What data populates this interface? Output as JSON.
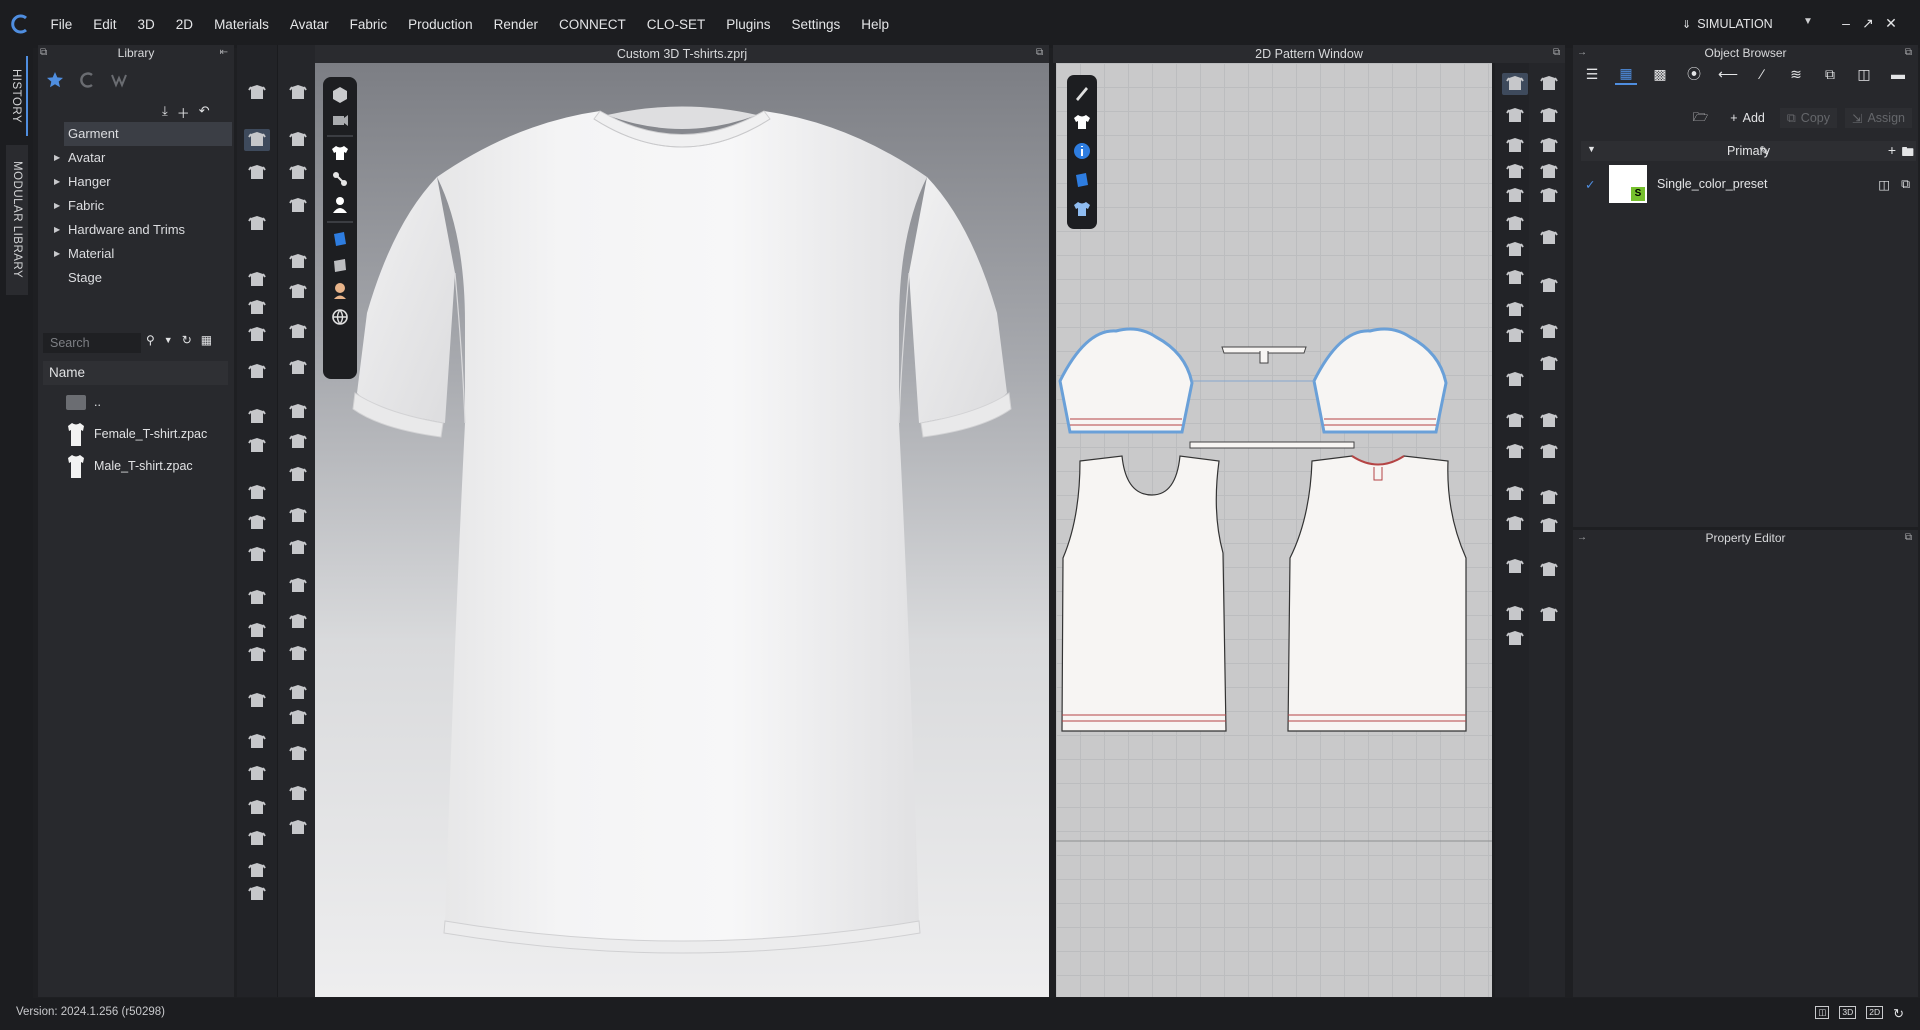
{
  "menu": {
    "items": [
      "File",
      "Edit",
      "3D",
      "2D",
      "Materials",
      "Avatar",
      "Fabric",
      "Production",
      "Render",
      "CONNECT",
      "CLO-SET",
      "Plugins",
      "Settings",
      "Help"
    ],
    "mode": "SIMULATION"
  },
  "vertical_tabs": {
    "history": "HISTORY",
    "modular_library": "MODULAR LIBRARY"
  },
  "library": {
    "title": "Library",
    "tree": [
      {
        "label": "Garment",
        "selected": true,
        "expandable": false
      },
      {
        "label": "Avatar",
        "expandable": true
      },
      {
        "label": "Hanger",
        "expandable": true
      },
      {
        "label": "Fabric",
        "expandable": true
      },
      {
        "label": "Hardware and Trims",
        "expandable": true
      },
      {
        "label": "Material",
        "expandable": true
      },
      {
        "label": "Stage",
        "expandable": false
      }
    ],
    "search_placeholder": "Search",
    "column_header": "Name",
    "files": [
      {
        "name": "..",
        "type": "folder"
      },
      {
        "name": "Female_T-shirt.zpac",
        "type": "garment"
      },
      {
        "name": "Male_T-shirt.zpac",
        "type": "garment"
      }
    ]
  },
  "view3d": {
    "title": "Custom 3D T-shirts.zprj"
  },
  "view2d": {
    "title": "2D Pattern Window"
  },
  "object_browser": {
    "title": "Object Browser",
    "buttons": {
      "add": "Add",
      "copy": "Copy",
      "assign": "Assign"
    },
    "group": "Primary",
    "items": [
      {
        "name": "Single_color_preset",
        "checked": true
      }
    ]
  },
  "property_editor": {
    "title": "Property Editor"
  },
  "status": {
    "version": "Version: 2024.1.256 (r50298)",
    "view_modes": [
      "3D",
      "2D"
    ]
  },
  "colors": {
    "accent": "#4f8ee0",
    "background": "#1e1f22",
    "panel": "#28292d",
    "pattern_outline": "#6aa0d8",
    "stitch": "#b44444"
  }
}
